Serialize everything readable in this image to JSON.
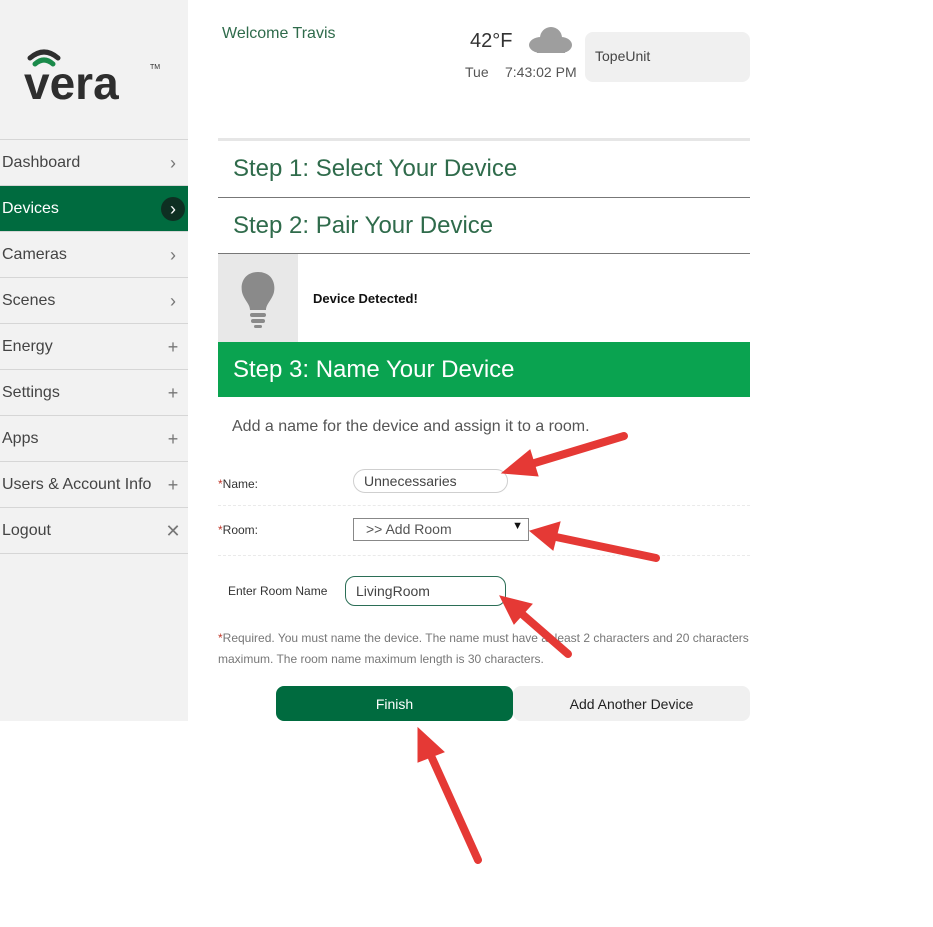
{
  "brand": {
    "logo_text": "vera"
  },
  "sidebar": {
    "items": [
      {
        "label": "Dashboard",
        "icon": "chevron-right-icon",
        "glyph": "›",
        "active": false
      },
      {
        "label": "Devices",
        "icon": "chevron-right-icon",
        "glyph": "›",
        "active": true
      },
      {
        "label": "Cameras",
        "icon": "chevron-right-icon",
        "glyph": "›",
        "active": false
      },
      {
        "label": "Scenes",
        "icon": "chevron-right-icon",
        "glyph": "›",
        "active": false
      },
      {
        "label": "Energy",
        "icon": "plus-icon",
        "glyph": "+",
        "active": false
      },
      {
        "label": "Settings",
        "icon": "plus-icon",
        "glyph": "+",
        "active": false
      },
      {
        "label": "Apps",
        "icon": "plus-icon",
        "glyph": "+",
        "active": false
      },
      {
        "label": "Users & Account Info",
        "icon": "plus-icon",
        "glyph": "+",
        "active": false
      },
      {
        "label": "Logout",
        "icon": "close-icon",
        "glyph": "✕",
        "active": false
      }
    ]
  },
  "header": {
    "welcome": "Welcome Travis",
    "temperature": "42°F",
    "weather_icon": "cloud-icon",
    "day": "Tue",
    "time": "7:43:02 PM",
    "unit_name": "TopeUnit"
  },
  "steps": {
    "step1": "Step 1: Select Your Device",
    "step2": "Step 2: Pair Your Device",
    "device_detected": "Device Detected!",
    "step3": "Step 3: Name Your Device"
  },
  "form": {
    "instructions": "Add a name for the device and assign it to a room.",
    "required_mark": "*",
    "name_label": "Name:",
    "name_value": "Unnecessaries",
    "room_label": "Room:",
    "room_selected": ">> Add Room",
    "room_name_label": "Enter Room Name",
    "room_name_value": "LivingRoom",
    "required_note": "Required. You must name the device. The name must have at least 2 characters and 20 characters maximum. The room name maximum length is 30 characters."
  },
  "buttons": {
    "finish": "Finish",
    "add_another": "Add Another Device"
  },
  "colors": {
    "brand_green": "#006b3f",
    "step_active_green": "#0aa350",
    "annotation_arrow": "#e53935"
  }
}
